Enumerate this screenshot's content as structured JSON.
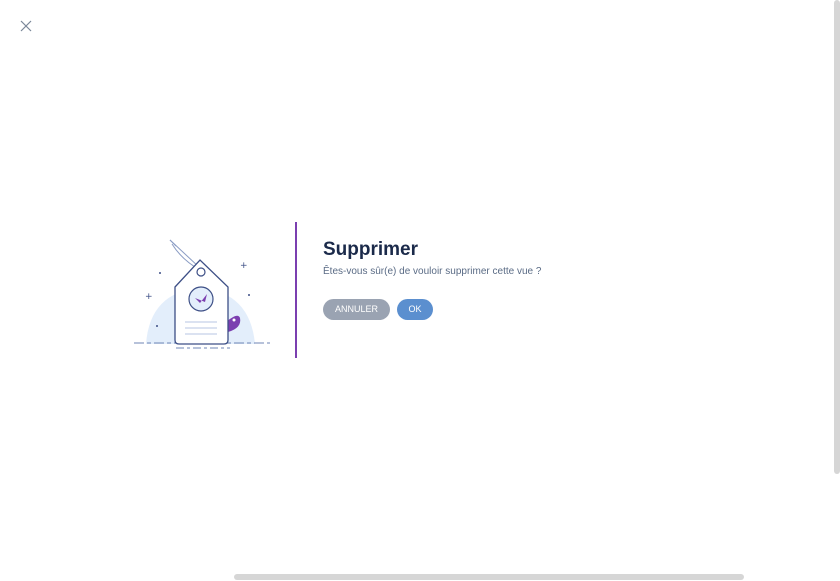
{
  "dialog": {
    "title": "Supprimer",
    "message": "Êtes-vous sûr(e) de vouloir supprimer cette vue ?",
    "cancel_label": "ANNULER",
    "ok_label": "OK"
  },
  "icons": {
    "close": "close-icon",
    "illustration": "price-tag-illustration"
  },
  "colors": {
    "accent": "#7b3fb0",
    "title": "#1b2a4a",
    "message": "#5a6b85",
    "ok_button": "#5b8fcf",
    "cancel_button": "#9aa3b2"
  }
}
